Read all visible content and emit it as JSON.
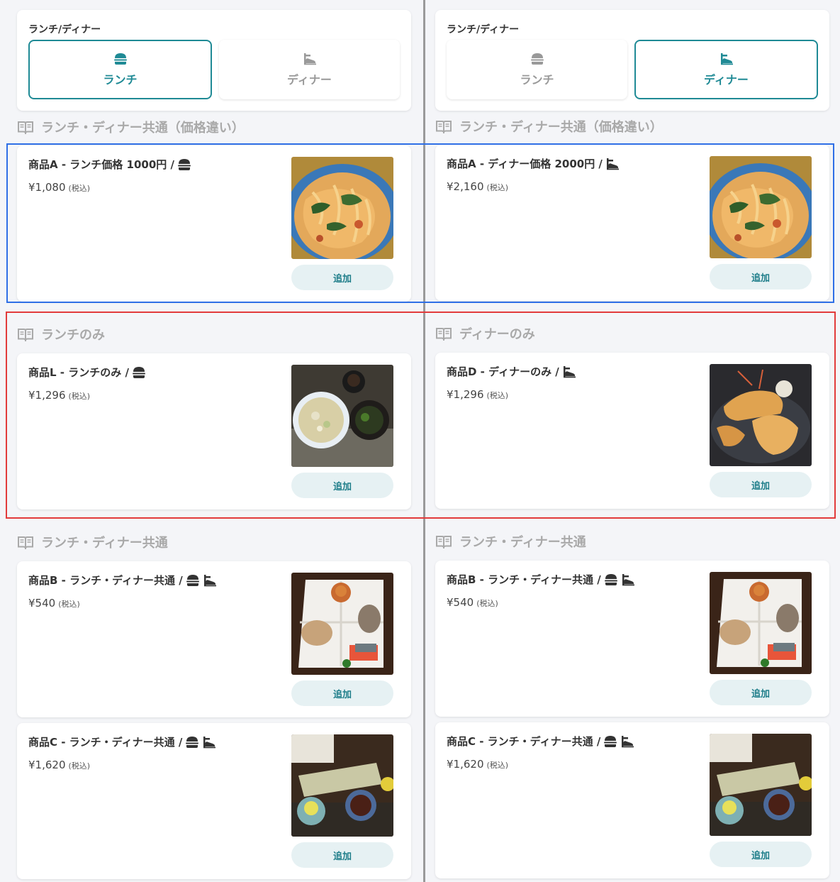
{
  "panels": [
    {
      "toggle": {
        "title": "ランチ/ディナー",
        "lunch_label": "ランチ",
        "dinner_label": "ディナー",
        "active": "lunch"
      },
      "sections": [
        {
          "title": "ランチ・ディナー共通（価格違い）",
          "items": [
            {
              "name": "商品A - ランチ価格 1000円 /",
              "icons": [
                "lunch-icon"
              ],
              "price": "¥1,080",
              "tax": "(税込)",
              "add_label": "追加",
              "photo": "pasta"
            }
          ]
        },
        {
          "title": "ランチのみ",
          "items": [
            {
              "name": "商品L - ランチのみ /",
              "icons": [
                "lunch-icon"
              ],
              "price": "¥1,296",
              "tax": "(税込)",
              "add_label": "追加",
              "photo": "lunch-set"
            }
          ]
        },
        {
          "title": "ランチ・ディナー共通",
          "items": [
            {
              "name": "商品B - ランチ・ディナー共通 /",
              "icons": [
                "lunch-icon",
                "dinner-icon"
              ],
              "price": "¥540",
              "tax": "(税込)",
              "add_label": "追加",
              "photo": "appetizer-plate"
            },
            {
              "name": "商品C - ランチ・ディナー共通 /",
              "icons": [
                "lunch-icon",
                "dinner-icon"
              ],
              "price": "¥1,620",
              "tax": "(税込)",
              "add_label": "追加",
              "photo": "sashimi-tray"
            }
          ]
        }
      ]
    },
    {
      "toggle": {
        "title": "ランチ/ディナー",
        "lunch_label": "ランチ",
        "dinner_label": "ディナー",
        "active": "dinner"
      },
      "sections": [
        {
          "title": "ランチ・ディナー共通（価格違い）",
          "items": [
            {
              "name": "商品A - ディナー価格 2000円 /",
              "icons": [
                "dinner-icon"
              ],
              "price": "¥2,160",
              "tax": "(税込)",
              "add_label": "追加",
              "photo": "pasta"
            }
          ]
        },
        {
          "title": "ディナーのみ",
          "items": [
            {
              "name": "商品D - ディナーのみ /",
              "icons": [
                "dinner-icon"
              ],
              "price": "¥1,296",
              "tax": "(税込)",
              "add_label": "追加",
              "photo": "fried-shrimp"
            }
          ]
        },
        {
          "title": "ランチ・ディナー共通",
          "items": [
            {
              "name": "商品B - ランチ・ディナー共通 /",
              "icons": [
                "lunch-icon",
                "dinner-icon"
              ],
              "price": "¥540",
              "tax": "(税込)",
              "add_label": "追加",
              "photo": "appetizer-plate"
            },
            {
              "name": "商品C - ランチ・ディナー共通 /",
              "icons": [
                "lunch-icon",
                "dinner-icon"
              ],
              "price": "¥1,620",
              "tax": "(税込)",
              "add_label": "追加",
              "photo": "sashimi-tray"
            }
          ]
        }
      ]
    }
  ],
  "colors": {
    "accent": "#1f8a95",
    "highlight_blue": "#2f6fe6",
    "highlight_red": "#e23b3b"
  }
}
